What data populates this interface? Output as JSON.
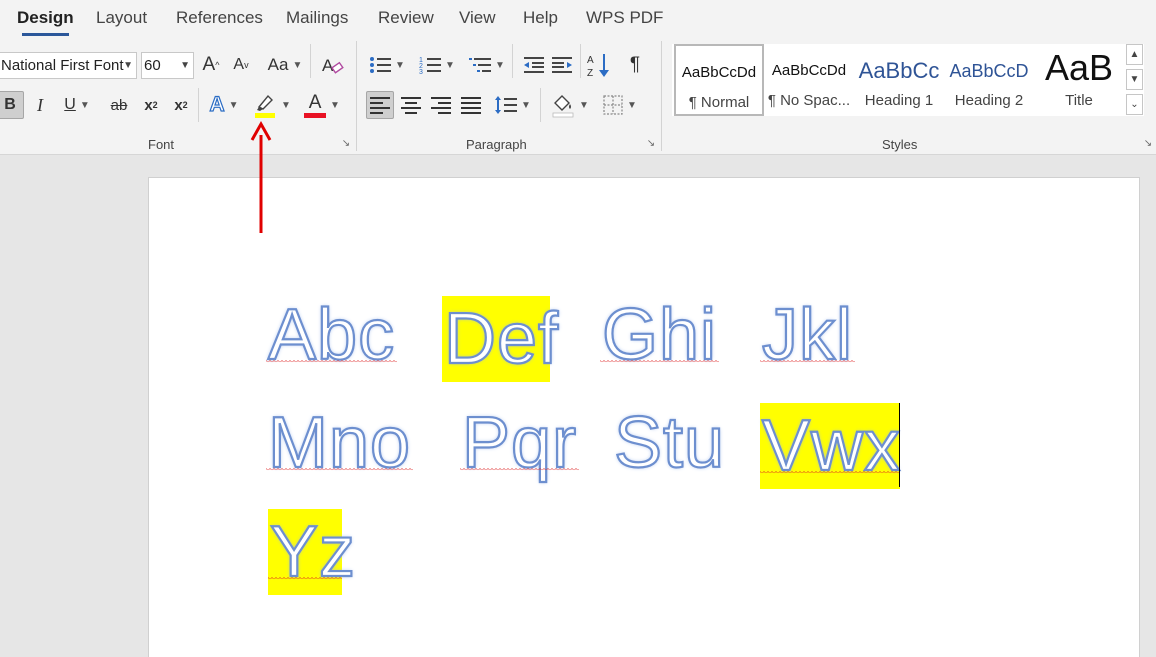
{
  "tabs": [
    "Design",
    "Layout",
    "References",
    "Mailings",
    "Review",
    "View",
    "Help",
    "WPS PDF"
  ],
  "font": {
    "name": "National First Font",
    "size": "60",
    "grow_glyph": "A",
    "shrink_glyph": "A",
    "case_label": "Aa",
    "bold": "B",
    "italic": "I",
    "underline": "U",
    "strike": "ab",
    "sub": "x",
    "sup": "x",
    "sub_mark": "2",
    "sup_mark": "2",
    "effects_glyph": "A",
    "color_glyph": "A",
    "group_label": "Font"
  },
  "paragraph": {
    "group_label": "Paragraph",
    "pilcrow": "¶"
  },
  "styles": {
    "group_label": "Styles",
    "items": [
      {
        "preview": "AaBbCcDd",
        "name": "¶ Normal"
      },
      {
        "preview": "AaBbCcDd",
        "name": "¶ No Spac..."
      },
      {
        "preview": "AaBbCc",
        "name": "Heading 1"
      },
      {
        "preview": "AaBbCcD",
        "name": "Heading 2"
      },
      {
        "preview": "AaB",
        "name": "Title"
      }
    ]
  },
  "colors": {
    "accent": "#2b579a",
    "highlight": "#ffff00",
    "font_color": "#e81123",
    "annotation": "#e00000"
  },
  "document": {
    "words": [
      {
        "text": "Abc",
        "highlighted": false
      },
      {
        "text": "Def",
        "highlighted": true
      },
      {
        "text": "Ghi",
        "highlighted": false
      },
      {
        "text": "Jkl",
        "highlighted": false
      },
      {
        "text": "Mno",
        "highlighted": false
      },
      {
        "text": "Pqr",
        "highlighted": false
      },
      {
        "text": "Stu",
        "highlighted": false
      },
      {
        "text": "Vwx",
        "highlighted": true
      },
      {
        "text": "Yz",
        "highlighted": true
      }
    ]
  }
}
